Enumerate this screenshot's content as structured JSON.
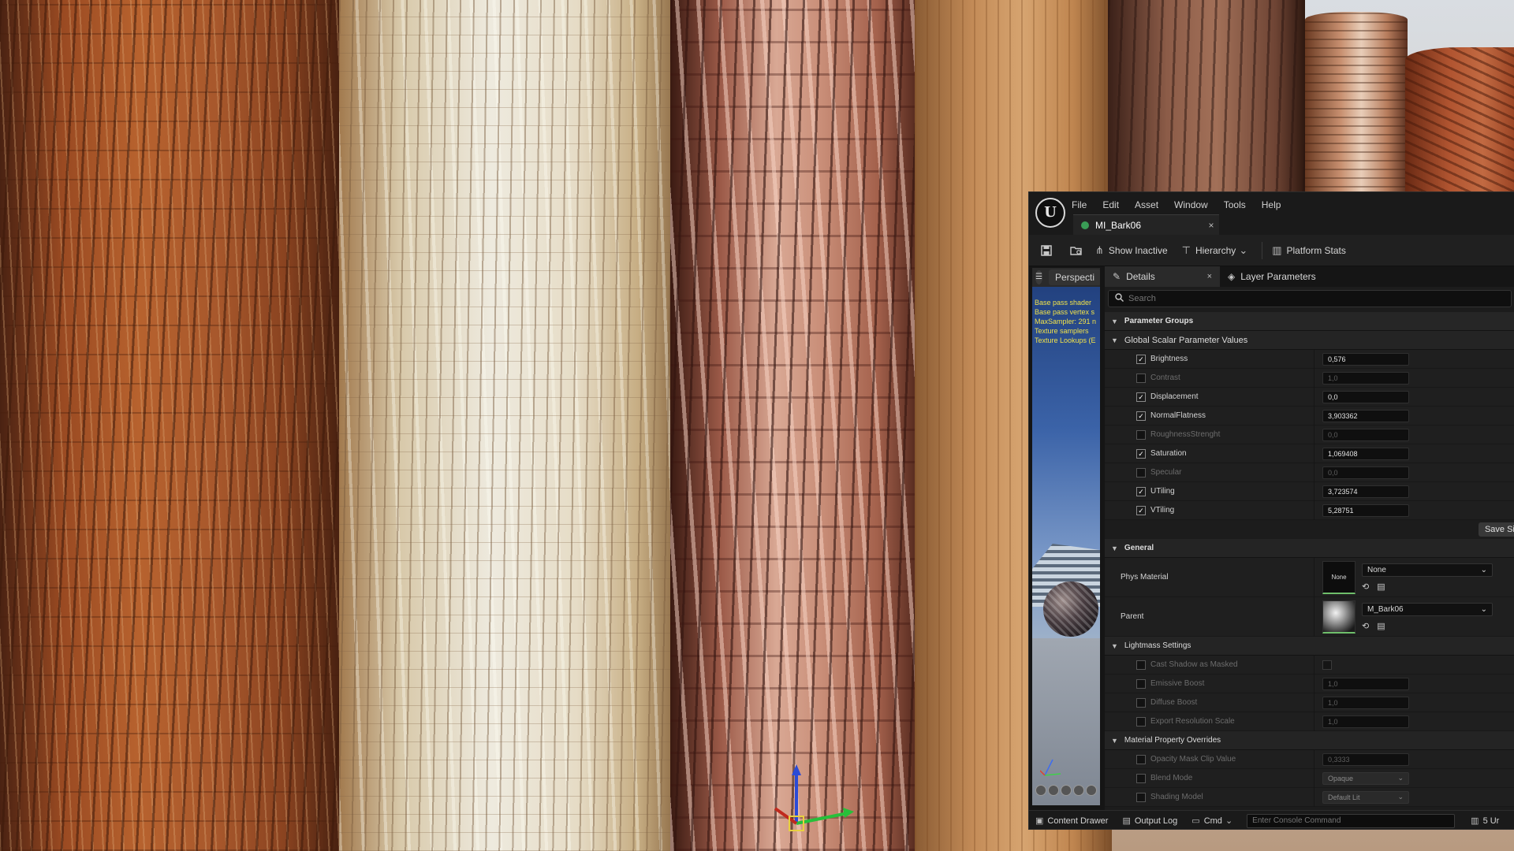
{
  "editor": {
    "menus": [
      "File",
      "Edit",
      "Asset",
      "Window",
      "Tools",
      "Help"
    ],
    "doc_tab": {
      "label": "MI_Bark06",
      "close": "×"
    },
    "toolbar": {
      "show_inactive": "Show Inactive",
      "hierarchy": "Hierarchy",
      "platform_stats": "Platform Stats"
    },
    "preview": {
      "tab_label": "Perspecti",
      "stats": [
        "Base pass shader",
        "Base pass vertex s",
        "MaxSampler: 291 n",
        "Texture samplers",
        "Texture Lookups (E"
      ]
    },
    "details": {
      "tabs": {
        "details": "Details",
        "layer_parameters": "Layer Parameters",
        "close": "×"
      },
      "search_placeholder": "Search",
      "parameter_groups": "Parameter Groups",
      "global_scalar": "Global Scalar Parameter Values",
      "scalars": [
        {
          "name": "Brightness",
          "value": "0,576",
          "enabled": true
        },
        {
          "name": "Contrast",
          "value": "1,0",
          "enabled": false
        },
        {
          "name": "Displacement",
          "value": "0,0",
          "enabled": true
        },
        {
          "name": "NormalFlatness",
          "value": "3,903362",
          "enabled": true
        },
        {
          "name": "RoughnessStrenght",
          "value": "0,0",
          "enabled": false
        },
        {
          "name": "Saturation",
          "value": "1,069408",
          "enabled": true
        },
        {
          "name": "Specular",
          "value": "0,0",
          "enabled": false
        },
        {
          "name": "UTiling",
          "value": "3,723574",
          "enabled": true
        },
        {
          "name": "VTiling",
          "value": "5,28751",
          "enabled": true
        }
      ],
      "save_button": "Save Sib",
      "general": "General",
      "phys_material": {
        "label": "Phys Material",
        "thumb": "None",
        "value": "None"
      },
      "parent": {
        "label": "Parent",
        "value": "M_Bark06"
      },
      "lightmass": "Lightmass Settings",
      "lightmass_props": [
        {
          "name": "Cast Shadow as Masked",
          "value": ""
        },
        {
          "name": "Emissive Boost",
          "value": "1,0"
        },
        {
          "name": "Diffuse Boost",
          "value": "1,0"
        },
        {
          "name": "Export Resolution Scale",
          "value": "1,0"
        }
      ],
      "overrides": "Material Property Overrides",
      "override_props": [
        {
          "name": "Opacity Mask Clip Value",
          "value": "0,3333"
        },
        {
          "name": "Blend Mode",
          "value": "Opaque"
        },
        {
          "name": "Shading Model",
          "value": "Default Lit"
        }
      ]
    },
    "bottombar": {
      "content_drawer": "Content Drawer",
      "output_log": "Output Log",
      "cmd": "Cmd",
      "console_placeholder": "Enter Console Command",
      "unsaved": "5 Ur"
    }
  },
  "colors": {
    "checked_accent": "#ffffff",
    "asset_underline": "#6fbf6b",
    "stats_text": "#f1e24a"
  }
}
